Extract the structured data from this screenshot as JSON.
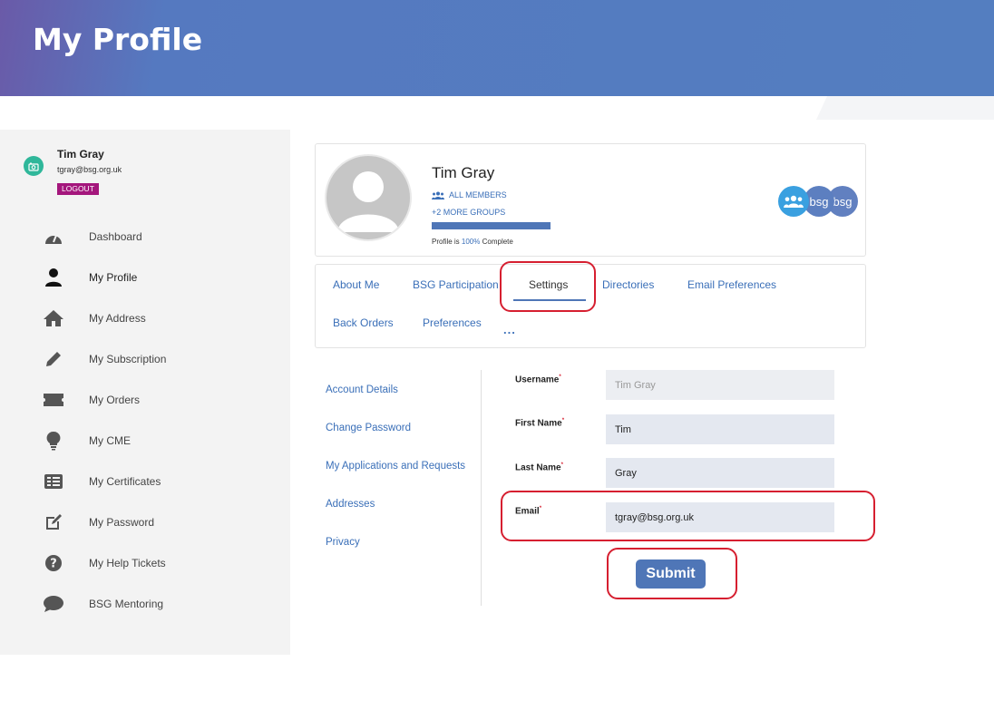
{
  "header": {
    "title": "My Profile"
  },
  "sidebar": {
    "user": {
      "name": "Tim Gray",
      "email": "tgray@bsg.org.uk",
      "logout_label": "LOGOUT"
    },
    "items": [
      {
        "label": "Dashboard",
        "icon": "dashboard-gauge-icon"
      },
      {
        "label": "My Profile",
        "icon": "person-icon"
      },
      {
        "label": "My Address",
        "icon": "home-icon"
      },
      {
        "label": "My Subscription",
        "icon": "pencil-icon"
      },
      {
        "label": "My Orders",
        "icon": "ticket-icon"
      },
      {
        "label": "My CME",
        "icon": "lightbulb-icon"
      },
      {
        "label": "My Certificates",
        "icon": "certificate-list-icon"
      },
      {
        "label": "My Password",
        "icon": "edit-square-icon"
      },
      {
        "label": "My Help Tickets",
        "icon": "question-circle-icon"
      },
      {
        "label": "BSG Mentoring",
        "icon": "chat-bubble-icon"
      }
    ]
  },
  "profile_card": {
    "name": "Tim Gray",
    "group_label": "ALL MEMBERS",
    "more_groups": "+2 MORE GROUPS",
    "completion_percent": 100,
    "completion_prefix": "Profile is ",
    "completion_value": "100%",
    "completion_suffix": " Complete",
    "badges": [
      {
        "text": "",
        "icon": "members-group-icon",
        "color": "#3aa0e0"
      },
      {
        "text": "bsg",
        "icon": "bsg-logo-icon",
        "color": "#5c7fc0"
      },
      {
        "text": "bsg",
        "icon": "bsg-logo-icon",
        "color": "#6180c0"
      }
    ]
  },
  "tabs": {
    "row1": [
      "About Me",
      "BSG Participation",
      "Settings",
      "Directories",
      "Email Preferences"
    ],
    "row2": [
      "Back Orders",
      "Preferences"
    ],
    "more": "...",
    "active": "Settings"
  },
  "settings_menu": [
    "Account Details",
    "Change Password",
    "My Applications and Requests",
    "Addresses",
    "Privacy"
  ],
  "form": {
    "username": {
      "label": "Username",
      "value": "Tim Gray",
      "required": "*"
    },
    "first_name": {
      "label": "First Name",
      "value": "Tim",
      "required": "*"
    },
    "last_name": {
      "label": "Last Name",
      "value": "Gray",
      "required": "*"
    },
    "email": {
      "label": "Email",
      "value": "tgray@bsg.org.uk",
      "required": "*"
    },
    "submit_label": "Submit"
  },
  "colors": {
    "accent": "#4f76b7",
    "link": "#3a6fb8",
    "logout": "#a4167c",
    "callout": "#d61f30",
    "avatar": "#2fb79a"
  }
}
